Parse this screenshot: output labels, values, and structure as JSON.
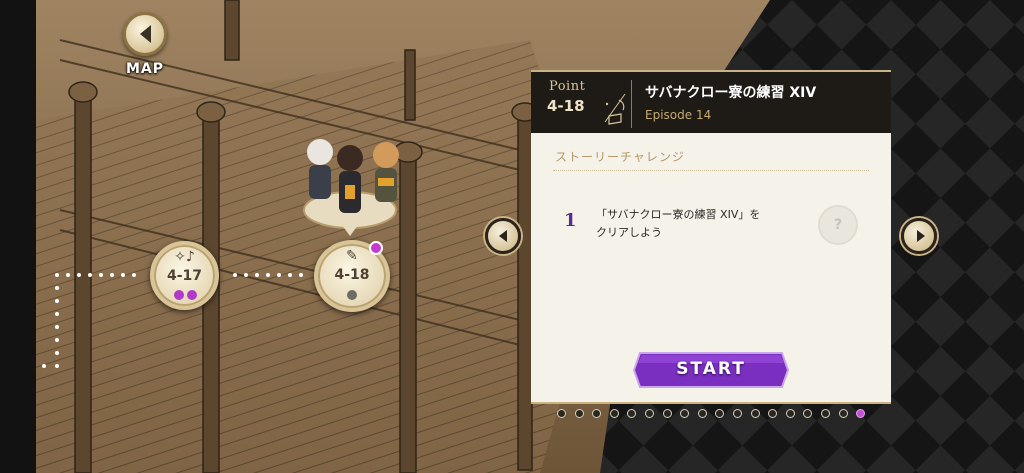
{
  "nav": {
    "map_label": "MAP"
  },
  "map": {
    "nodes": [
      {
        "label": "4-17",
        "icon": "music-notes-icon",
        "dots": [
          "#b139c9",
          "#b139c9"
        ]
      },
      {
        "label": "4-18",
        "icon": "quill-scroll-icon",
        "dots": [
          "#6f6b66"
        ],
        "new_badge_color": "#c43ccd"
      }
    ]
  },
  "stage_panel": {
    "point_word": "Point",
    "point_number": "4-18",
    "title": "サバナクロー寮の練習 XIV",
    "episode": "Episode 14",
    "section_title": "ストーリーチャレンジ",
    "challenges": [
      {
        "number": "1",
        "text_line1": "「サバナクロー寮の練習 XIV」を",
        "text_line2": "クリアしよう",
        "reward_placeholder": "?"
      }
    ],
    "start_label": "START",
    "accent_color": "#7a2fc0"
  },
  "pagination": {
    "total": 18,
    "active_index": 17,
    "active_color": "#c84fd4"
  }
}
